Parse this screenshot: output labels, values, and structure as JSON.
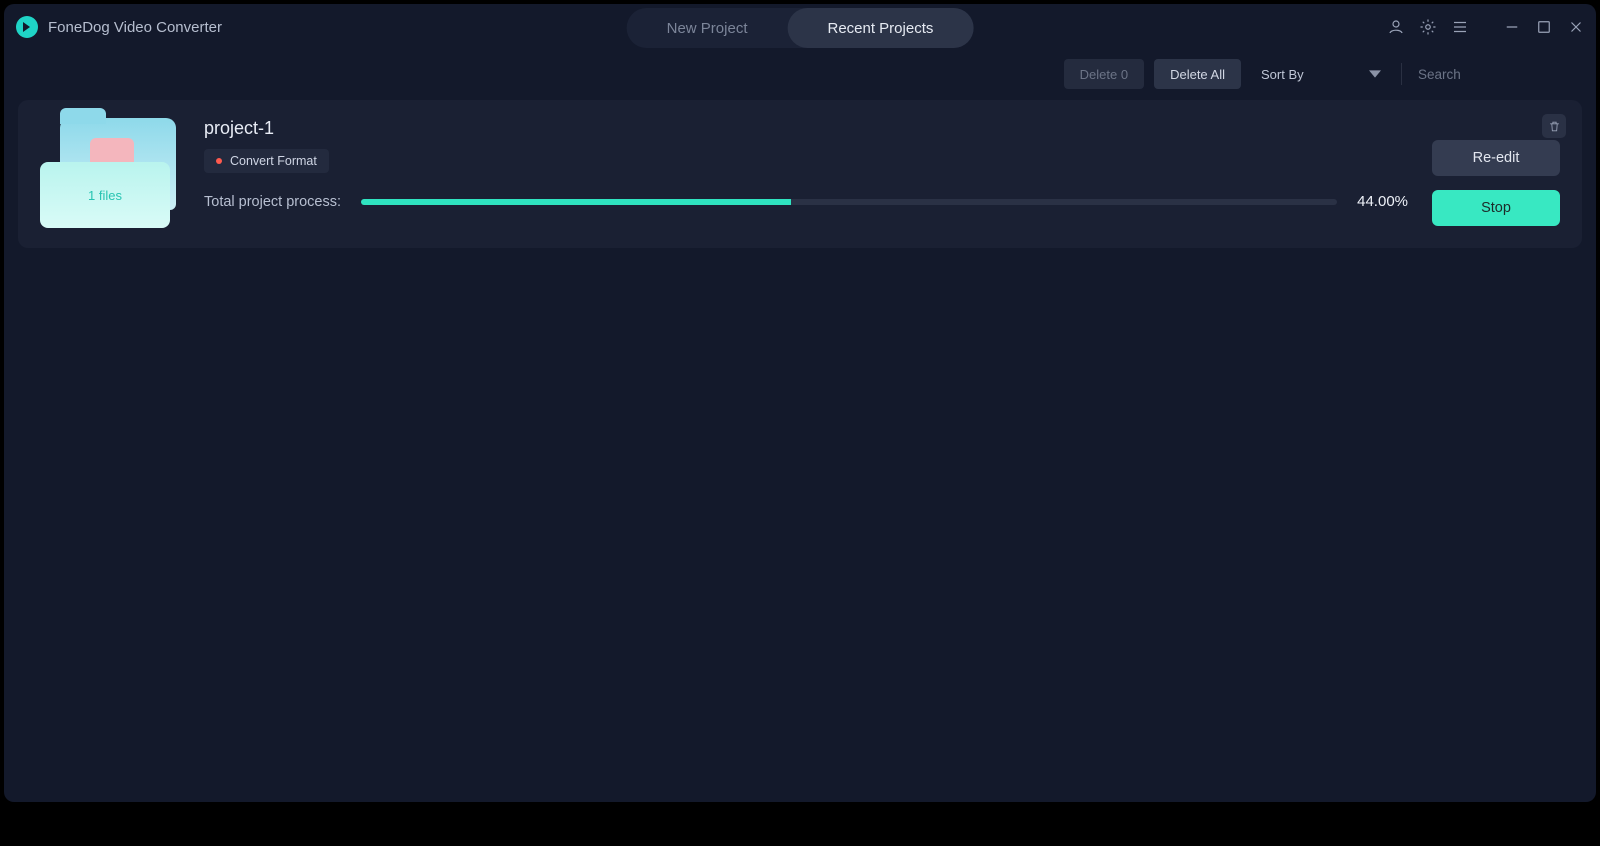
{
  "app_title": "FoneDog Video Converter",
  "tabs": {
    "new": "New Project",
    "recent": "Recent Projects"
  },
  "toolbar": {
    "delete_n": "Delete 0",
    "delete_all": "Delete All",
    "sort_by": "Sort By",
    "search_placeholder": "Search"
  },
  "project": {
    "name": "project-1",
    "tag": "Convert Format",
    "files_label": "1 files",
    "process_label": "Total project process:",
    "percent_text": "44.00%",
    "percent_value": 44,
    "reedit": "Re-edit",
    "stop": "Stop"
  }
}
